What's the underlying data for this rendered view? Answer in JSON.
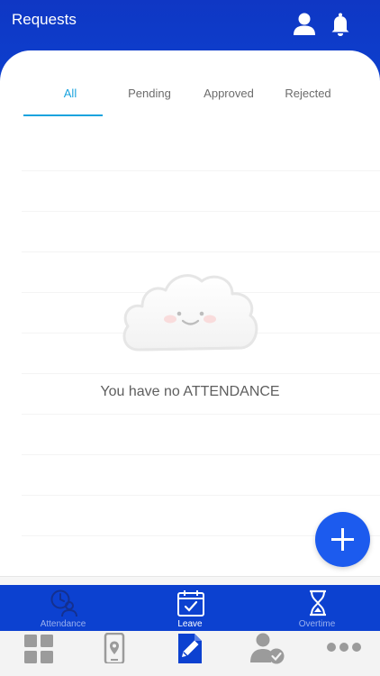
{
  "header": {
    "title": "Requests",
    "icons": [
      "profile-icon",
      "bell-icon"
    ]
  },
  "tabs": [
    {
      "label": "All",
      "active": true
    },
    {
      "label": "Pending",
      "active": false
    },
    {
      "label": "Approved",
      "active": false
    },
    {
      "label": "Rejected",
      "active": false
    }
  ],
  "empty_state": {
    "icon": "smiling-cloud-icon",
    "message": "You have no ATTENDANCE"
  },
  "fab": {
    "icon": "plus-icon"
  },
  "sub_nav": [
    {
      "label": "Attendance",
      "icon": "attendance-clock-user-icon"
    },
    {
      "label": "Leave",
      "icon": "calendar-check-icon"
    },
    {
      "label": "Overtime",
      "icon": "hourglass-icon"
    }
  ],
  "bottom_nav": [
    {
      "icon": "dashboard-grid-icon",
      "active": false
    },
    {
      "icon": "phone-location-icon",
      "active": false
    },
    {
      "icon": "document-edit-icon",
      "active": true
    },
    {
      "icon": "user-check-icon",
      "active": false
    },
    {
      "icon": "more-dots-icon",
      "active": false
    }
  ],
  "colors": {
    "primary": "#0c41d0",
    "tab_active": "#1aa3de",
    "fab": "#1c5bee",
    "text_muted": "#6c6c6c"
  }
}
